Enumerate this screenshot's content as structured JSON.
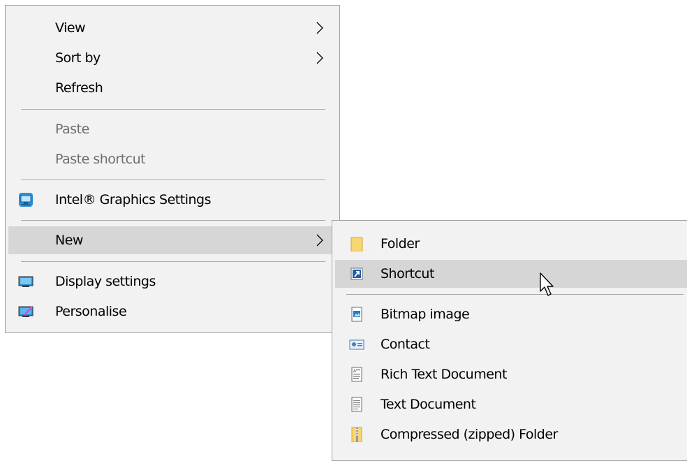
{
  "context_menu": {
    "items": [
      {
        "label": "View",
        "has_submenu": true,
        "enabled": true
      },
      {
        "label": "Sort by",
        "has_submenu": true,
        "enabled": true
      },
      {
        "label": "Refresh",
        "enabled": true
      },
      {
        "label": "Paste",
        "enabled": false
      },
      {
        "label": "Paste shortcut",
        "enabled": false
      },
      {
        "label": "Intel® Graphics Settings",
        "icon": "intel-graphics-icon",
        "enabled": true
      },
      {
        "label": "New",
        "has_submenu": true,
        "highlighted": true,
        "enabled": true
      },
      {
        "label": "Display settings",
        "icon": "display-icon",
        "enabled": true
      },
      {
        "label": "Personalise",
        "icon": "personalise-icon",
        "enabled": true
      }
    ]
  },
  "new_submenu": {
    "items": [
      {
        "label": "Folder",
        "icon": "folder-icon"
      },
      {
        "label": "Shortcut",
        "icon": "shortcut-icon",
        "highlighted": true
      },
      {
        "label": "Bitmap image",
        "icon": "bitmap-icon"
      },
      {
        "label": "Contact",
        "icon": "contact-icon"
      },
      {
        "label": "Rich Text Document",
        "icon": "rich-text-icon"
      },
      {
        "label": "Text Document",
        "icon": "text-document-icon"
      },
      {
        "label": "Compressed (zipped) Folder",
        "icon": "zip-folder-icon"
      }
    ]
  },
  "colors": {
    "menu_background": "#f2f2f2",
    "highlight": "#d6d6d6",
    "disabled_text": "#6d6d6d",
    "separator": "#a9a9a9"
  }
}
